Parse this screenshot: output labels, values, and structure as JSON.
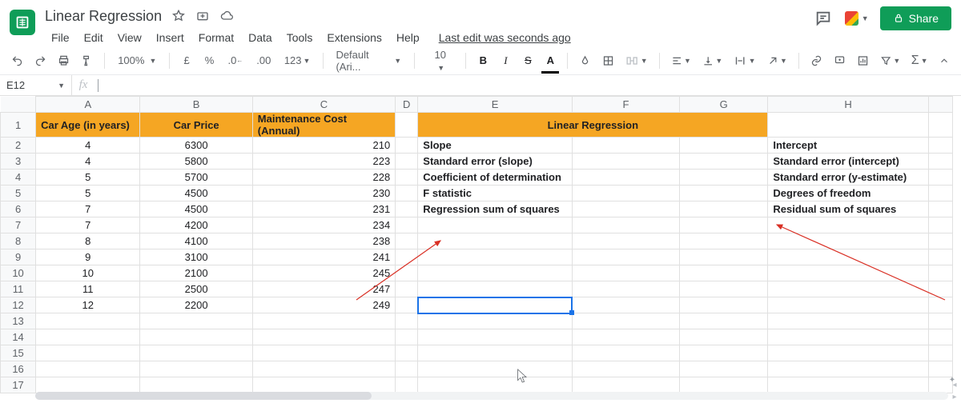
{
  "doc": {
    "title": "Linear Regression",
    "last_edit": "Last edit was seconds ago"
  },
  "menu": {
    "file": "File",
    "edit": "Edit",
    "view": "View",
    "insert": "Insert",
    "format": "Format",
    "data": "Data",
    "tools": "Tools",
    "extensions": "Extensions",
    "help": "Help"
  },
  "share": {
    "label": "Share"
  },
  "toolbar": {
    "zoom": "100%",
    "currency": "£",
    "percent": "%",
    "dec_dec": ".0",
    "dec_inc": ".00",
    "fmt": "123",
    "font": "Default (Ari...",
    "fsize": "10",
    "bold": "B",
    "italic": "I",
    "strike": "S",
    "tcolor": "A",
    "sigma": "Σ"
  },
  "namebox": "E12",
  "columns": [
    "A",
    "B",
    "C",
    "D",
    "E",
    "F",
    "G",
    "H"
  ],
  "headers": {
    "a": "Car Age (in years)",
    "b": "Car Price",
    "c": "Maintenance Cost (Annual)",
    "efg": "Linear Regression"
  },
  "rows": [
    {
      "a": "4",
      "b": "6300",
      "c": "210",
      "e": "Slope",
      "h": "Intercept"
    },
    {
      "a": "4",
      "b": "5800",
      "c": "223",
      "e": "Standard error (slope)",
      "h": "Standard error (intercept)"
    },
    {
      "a": "5",
      "b": "5700",
      "c": "228",
      "e": "Coefficient of determination",
      "h": "Standard error (y-estimate)"
    },
    {
      "a": "5",
      "b": "4500",
      "c": "230",
      "e": "F statistic",
      "h": "Degrees of freedom"
    },
    {
      "a": "7",
      "b": "4500",
      "c": "231",
      "e": "Regression sum of squares",
      "h": "Residual sum of squares"
    },
    {
      "a": "7",
      "b": "4200",
      "c": "234",
      "e": "",
      "h": ""
    },
    {
      "a": "8",
      "b": "4100",
      "c": "238",
      "e": "",
      "h": ""
    },
    {
      "a": "9",
      "b": "3100",
      "c": "241",
      "e": "",
      "h": ""
    },
    {
      "a": "10",
      "b": "2100",
      "c": "245",
      "e": "",
      "h": ""
    },
    {
      "a": "11",
      "b": "2500",
      "c": "247",
      "e": "",
      "h": ""
    },
    {
      "a": "12",
      "b": "2200",
      "c": "249",
      "e": "",
      "h": ""
    }
  ]
}
